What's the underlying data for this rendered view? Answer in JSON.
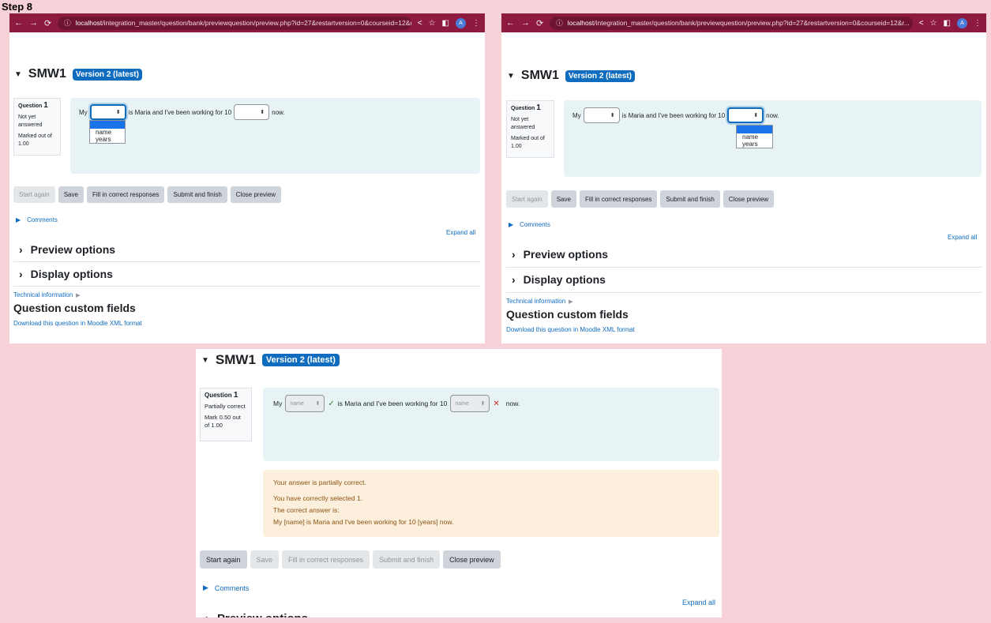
{
  "step_label": "Step 8",
  "browser": {
    "url_host": "localhost",
    "url_path": "/integration_master/question/bank/previewquestion/preview.php?id=27&restartversion=0&courseid=12&r...",
    "avatar": "A"
  },
  "question": {
    "name": "SMW1",
    "version_badge": "Version 2 (latest)",
    "number_label": "Question",
    "number": "1",
    "text_my": "My",
    "text_mid": "is Maria and I've been working for 10",
    "text_end": "now."
  },
  "state_before": {
    "status": "Not yet answered",
    "mark": "Marked out of 1.00",
    "dropdown_options": [
      "name",
      "years"
    ]
  },
  "state_after": {
    "status": "Partially correct",
    "mark": "Mark 0.50 out of 1.00",
    "select1_value": "name",
    "select2_value": "name",
    "feedback": {
      "line1": "Your answer is partially correct.",
      "line2": "You have correctly selected 1.",
      "line3": "The correct answer is:",
      "line4": "My [name] is Maria and I've been working for 10 [years] now."
    }
  },
  "buttons": {
    "start_again": "Start again",
    "save": "Save",
    "fill_correct": "Fill in correct responses",
    "submit_finish": "Submit and finish",
    "close_preview": "Close preview"
  },
  "links": {
    "comments": "Comments",
    "expand_all": "Expand all",
    "preview_options": "Preview options",
    "display_options": "Display options",
    "technical_information": "Technical information",
    "custom_fields_heading": "Question custom fields",
    "download_xml": "Download this question in Moodle XML format"
  },
  "icons": {
    "caret_down": "caret-down-icon",
    "chevron_right": "chevron-right-icon",
    "check": "check-icon",
    "cross": "cross-icon"
  },
  "colors": {
    "background": "#f6d1d7",
    "browser_bar": "#8e1a3f",
    "badge": "#0f6cbf",
    "question_box": "#e7f3f5",
    "feedback_box": "#fcefdc"
  }
}
